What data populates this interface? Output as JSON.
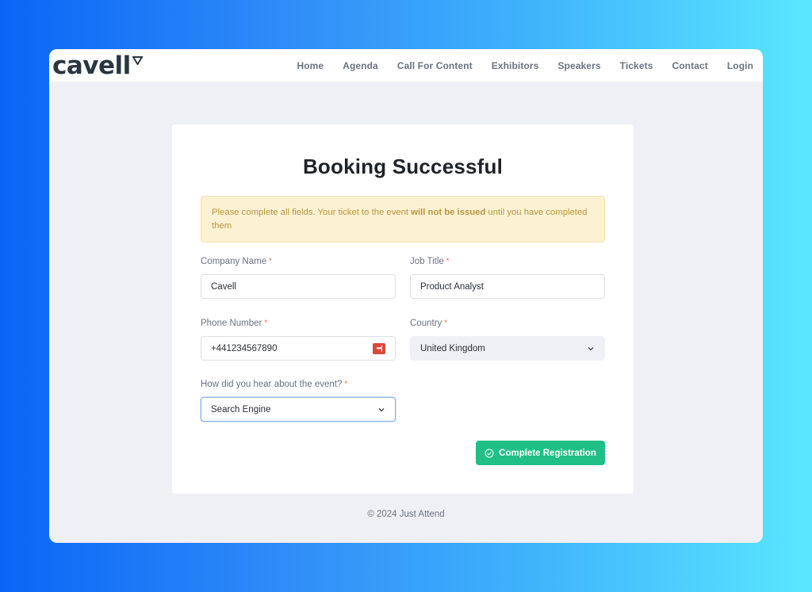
{
  "header": {
    "logo": "cavell",
    "nav": [
      "Home",
      "Agenda",
      "Call For Content",
      "Exhibitors",
      "Speakers",
      "Tickets",
      "Contact",
      "Login"
    ]
  },
  "main": {
    "title": "Booking Successful",
    "alert": {
      "pre": "Please complete all fields. Your ticket to the event ",
      "bold": "will not be issued",
      "post": " until you have completed them"
    },
    "fields": {
      "company": {
        "label": "Company Name",
        "value": "Cavell"
      },
      "job": {
        "label": "Job Title",
        "value": "Product Analyst"
      },
      "phone": {
        "label": "Phone Number",
        "value": "+441234567890",
        "icon": "password-manager-icon",
        "icon_glyph": "•••|"
      },
      "country": {
        "label": "Country",
        "value": "United Kingdom"
      },
      "source": {
        "label": "How did you hear about the event?",
        "value": "Search Engine"
      }
    },
    "required_mark": "*",
    "submit_label": "Complete Registration"
  },
  "footer": {
    "text": "© 2024 Just Attend"
  },
  "colors": {
    "accent": "#20bf85",
    "alert_bg": "#fdf1d3",
    "alert_text": "#b8953c",
    "required": "#e05a2b"
  }
}
